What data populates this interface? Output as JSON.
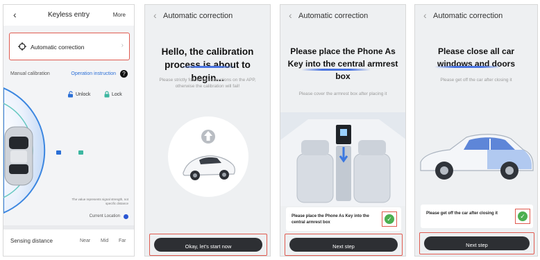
{
  "screen1": {
    "back_icon": "chevron-left-icon",
    "title": "Keyless entry",
    "more": "More",
    "auto_label": "Automatic correction",
    "manual_label": "Manual calibration",
    "instruction_link": "Operation instruction",
    "unlock_label": "Unlock",
    "lock_label": "Lock",
    "signal_note": "The value represents signal strength, not specific distance",
    "current_location": "Current Location",
    "sensing_label": "Sensing distance",
    "options": [
      "Near",
      "Mid",
      "Far"
    ]
  },
  "screen2": {
    "header_title": "Automatic correction",
    "headline": "Hello, the calibration process is about to begin...",
    "subtext": "Please strictly follow the instructions on the APP, otherwise the calibration will fail!",
    "button_label": "Okay, let's start now"
  },
  "screen3": {
    "header_title": "Automatic correction",
    "headline": "Please place the Phone As Key into the central armrest box",
    "subtext": "Please cover the armrest box after placing it",
    "confirm_text": "Please place the Phone As Key into the central armrest box",
    "button_label": "Next step"
  },
  "screen4": {
    "header_title": "Automatic correction",
    "headline": "Please close all car windows and doors",
    "subtext": "Please get off the car after closing it",
    "confirm_text": "Please get off the car after closing it",
    "button_label": "Next step"
  },
  "colors": {
    "highlight": "#e05a4f",
    "accent": "#4a74e0",
    "button": "#2d2f33",
    "check": "#4caf50"
  }
}
